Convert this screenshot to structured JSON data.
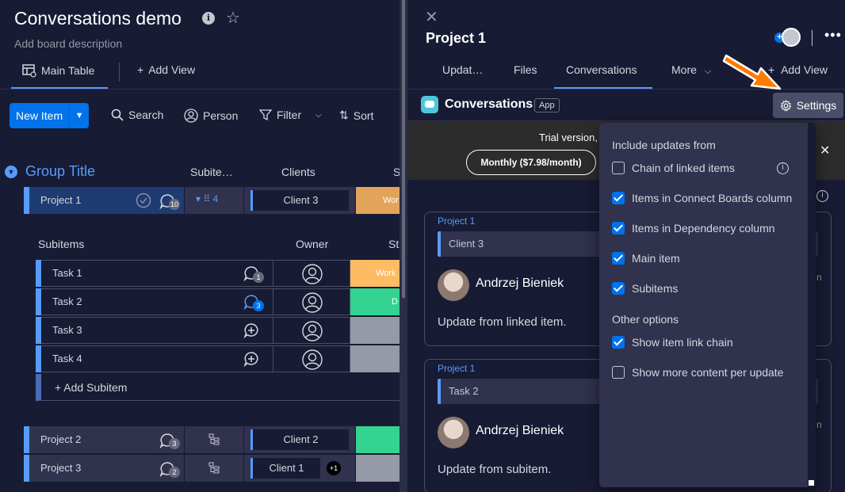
{
  "board": {
    "title": "Conversations demo",
    "description": "Add board description",
    "views": {
      "main": "Main Table",
      "add": "Add View"
    },
    "toolbar": {
      "new_item": "New Item",
      "search": "Search",
      "person": "Person",
      "filter": "Filter",
      "sort": "Sort"
    },
    "group": {
      "title": "Group Title",
      "columns": [
        "Subite…",
        "Clients",
        "S"
      ]
    },
    "items": [
      {
        "name": "Project 1",
        "updates": "10",
        "client": "Client 3",
        "status": "Wor",
        "status_color": "#e2a35a"
      },
      {
        "name": "Project 2",
        "updates": "3",
        "client": "Client 2",
        "status": "",
        "status_color": "#33d391"
      },
      {
        "name": "Project 3",
        "updates": "2",
        "client": "Client 1",
        "extra_clients": "+1",
        "status": "",
        "status_color": "#9699a6"
      }
    ],
    "subitems": {
      "header": "Subitems",
      "owner_header": "Owner",
      "status_header": "St",
      "rows": [
        {
          "name": "Task 1",
          "updates": "1",
          "status": "Work",
          "status_color": "#fdbc64"
        },
        {
          "name": "Task 2",
          "updates": "3",
          "status": "D",
          "status_color": "#33d391"
        },
        {
          "name": "Task 3",
          "updates": "",
          "status": "",
          "status_color": "#9699a6"
        },
        {
          "name": "Task 4",
          "updates": "",
          "status": "",
          "status_color": "#9699a6"
        }
      ],
      "add_label": "+ Add Subitem"
    }
  },
  "panel": {
    "title": "Project 1",
    "tabs": [
      "Updat…",
      "Files",
      "Conversations",
      "More",
      "Add View"
    ],
    "active_tab": "Conversations",
    "app": {
      "name": "Conversations",
      "badge": "App"
    },
    "settings_label": "Settings",
    "trial": {
      "text": "Trial version,",
      "button": "Monthly ($7.98/month)"
    },
    "cards": [
      {
        "project": "Project 1",
        "chip": "Client 3",
        "author": "Andrzej Bieniek",
        "text": "Update from linked item.",
        "edge": "n"
      },
      {
        "project": "Project 1",
        "chip": "Task 2",
        "author": "Andrzej Bieniek",
        "text": "Update from subitem.",
        "edge": "n"
      }
    ]
  },
  "settings": {
    "section1": "Include updates from",
    "options1": [
      {
        "label": "Chain of linked items",
        "checked": false
      },
      {
        "label": "Items in Connect Boards column",
        "checked": true
      },
      {
        "label": "Items in Dependency column",
        "checked": true
      },
      {
        "label": "Main item",
        "checked": true
      },
      {
        "label": "Subitems",
        "checked": true
      }
    ],
    "section2": "Other options",
    "options2": [
      {
        "label": "Show item link chain",
        "checked": true
      },
      {
        "label": "Show more content per update",
        "checked": false
      }
    ]
  },
  "colors": {
    "accent": "#0073ea",
    "group": "#579bfc",
    "arrow": "#ff7a00"
  }
}
